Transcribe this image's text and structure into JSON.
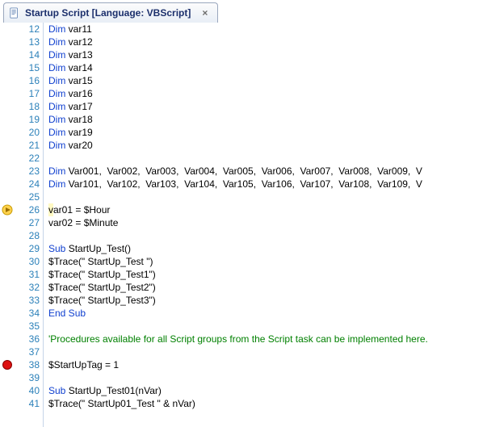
{
  "tab": {
    "title": "Startup Script [Language: VBScript]",
    "close": "×"
  },
  "editor": {
    "first_line_number": 12,
    "markers": [
      {
        "type": "arrow",
        "line": 26
      },
      {
        "type": "breakpoint",
        "line": 38
      }
    ],
    "highlighted_line": 26,
    "lines": [
      {
        "n": 12,
        "tokens": [
          {
            "t": "Dim",
            "c": "kw"
          },
          {
            "t": " var11",
            "c": "var"
          }
        ]
      },
      {
        "n": 13,
        "tokens": [
          {
            "t": "Dim",
            "c": "kw"
          },
          {
            "t": " var12",
            "c": "var"
          }
        ]
      },
      {
        "n": 14,
        "tokens": [
          {
            "t": "Dim",
            "c": "kw"
          },
          {
            "t": " var13",
            "c": "var"
          }
        ]
      },
      {
        "n": 15,
        "tokens": [
          {
            "t": "Dim",
            "c": "kw"
          },
          {
            "t": " var14",
            "c": "var"
          }
        ]
      },
      {
        "n": 16,
        "tokens": [
          {
            "t": "Dim",
            "c": "kw"
          },
          {
            "t": " var15",
            "c": "var"
          }
        ]
      },
      {
        "n": 17,
        "tokens": [
          {
            "t": "Dim",
            "c": "kw"
          },
          {
            "t": " var16",
            "c": "var"
          }
        ]
      },
      {
        "n": 18,
        "tokens": [
          {
            "t": "Dim",
            "c": "kw"
          },
          {
            "t": " var17",
            "c": "var"
          }
        ]
      },
      {
        "n": 19,
        "tokens": [
          {
            "t": "Dim",
            "c": "kw"
          },
          {
            "t": " var18",
            "c": "var"
          }
        ]
      },
      {
        "n": 20,
        "tokens": [
          {
            "t": "Dim",
            "c": "kw"
          },
          {
            "t": " var19",
            "c": "var"
          }
        ]
      },
      {
        "n": 21,
        "tokens": [
          {
            "t": "Dim",
            "c": "kw"
          },
          {
            "t": " var20",
            "c": "var"
          }
        ]
      },
      {
        "n": 22,
        "tokens": []
      },
      {
        "n": 23,
        "tokens": [
          {
            "t": "Dim",
            "c": "kw"
          },
          {
            "t": " Var001,  Var002,  Var003,  Var004,  Var005,  Var006,  Var007,  Var008,  Var009,  V",
            "c": "var"
          }
        ]
      },
      {
        "n": 24,
        "tokens": [
          {
            "t": "Dim",
            "c": "kw"
          },
          {
            "t": " Var101,  Var102,  Var103,  Var104,  Var105,  Var106,  Var107,  Var108,  Var109,  V",
            "c": "var"
          }
        ]
      },
      {
        "n": 25,
        "tokens": []
      },
      {
        "n": 26,
        "tokens": [
          {
            "t": "var01 = $Hour",
            "c": "plain"
          }
        ]
      },
      {
        "n": 27,
        "tokens": [
          {
            "t": "var02 = $Minute",
            "c": "plain"
          }
        ]
      },
      {
        "n": 28,
        "tokens": []
      },
      {
        "n": 29,
        "tokens": [
          {
            "t": "Sub",
            "c": "kw"
          },
          {
            "t": " StartUp_Test()",
            "c": "plain"
          }
        ]
      },
      {
        "n": 30,
        "tokens": [
          {
            "t": "$Trace(\" StartUp_Test \")",
            "c": "plain"
          }
        ]
      },
      {
        "n": 31,
        "tokens": [
          {
            "t": "$Trace(\" StartUp_Test1\")",
            "c": "plain"
          }
        ]
      },
      {
        "n": 32,
        "tokens": [
          {
            "t": "$Trace(\" StartUp_Test2\")",
            "c": "plain"
          }
        ]
      },
      {
        "n": 33,
        "tokens": [
          {
            "t": "$Trace(\" StartUp_Test3\")",
            "c": "plain"
          }
        ]
      },
      {
        "n": 34,
        "tokens": [
          {
            "t": "End Sub",
            "c": "kw"
          }
        ]
      },
      {
        "n": 35,
        "tokens": []
      },
      {
        "n": 36,
        "tokens": [
          {
            "t": "'Procedures available for all Script groups from the Script task can be implemented here.",
            "c": "comment"
          }
        ]
      },
      {
        "n": 37,
        "tokens": []
      },
      {
        "n": 38,
        "tokens": [
          {
            "t": "$StartUpTag = 1",
            "c": "plain"
          }
        ]
      },
      {
        "n": 39,
        "tokens": []
      },
      {
        "n": 40,
        "tokens": [
          {
            "t": "Sub",
            "c": "kw"
          },
          {
            "t": " StartUp_Test01(nVar)",
            "c": "plain"
          }
        ]
      },
      {
        "n": 41,
        "tokens": [
          {
            "t": "$Trace(\" StartUp01_Test \" & nVar)",
            "c": "plain"
          }
        ]
      }
    ]
  }
}
